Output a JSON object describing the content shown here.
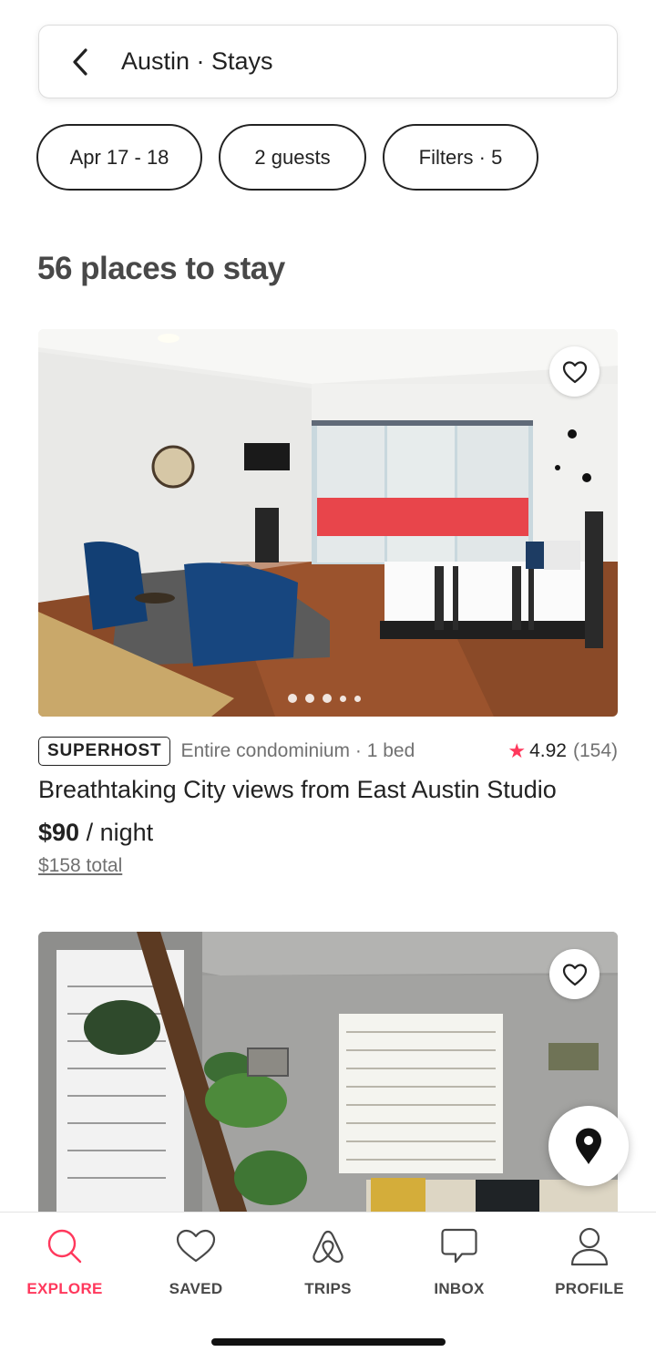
{
  "search": {
    "title": "Austin · Stays"
  },
  "filters": {
    "dates": "Apr 17 - 18",
    "guests": "2 guests",
    "filters": "Filters · 5"
  },
  "results": {
    "heading": "56 places to stay"
  },
  "listings": [
    {
      "badge": "SUPERHOST",
      "room_type": "Entire condominium · 1 bed",
      "rating_star": "★",
      "rating": "4.92",
      "reviews": "(154)",
      "title": "Breathtaking City views from East Austin Studio",
      "price": "$90",
      "per_night": " / night",
      "total": "$158 total",
      "photo_count": 5,
      "active_photo": 1
    },
    {
      "photo_count": 5,
      "active_photo": 1
    }
  ],
  "nav": {
    "explore": "EXPLORE",
    "saved": "SAVED",
    "trips": "TRIPS",
    "inbox": "INBOX",
    "profile": "PROFILE"
  },
  "colors": {
    "accent": "#ff385c",
    "text": "#222222",
    "muted": "#717171"
  },
  "icons": [
    "chevron-left-icon",
    "heart-icon",
    "map-pin-icon",
    "search-icon",
    "airbnb-logo-icon",
    "message-icon",
    "user-icon"
  ]
}
